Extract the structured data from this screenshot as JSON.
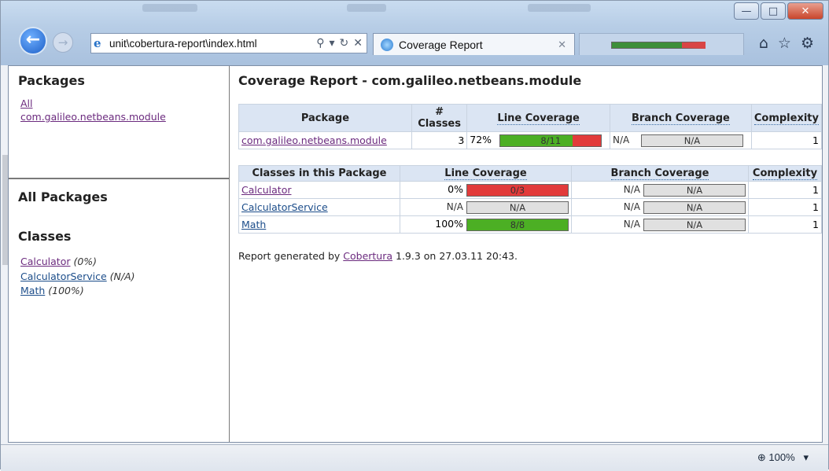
{
  "browser": {
    "address": "unit\\cobertura-report\\index.html",
    "tab_title": "Coverage Report",
    "zoom": "100%"
  },
  "left": {
    "packages_heading": "Packages",
    "package_links": [
      "All",
      "com.galileo.netbeans.module"
    ],
    "all_packages_heading": "All Packages",
    "classes_heading": "Classes",
    "classes": [
      {
        "name": "Calculator",
        "pct": "(0%)"
      },
      {
        "name": "CalculatorService",
        "pct": "(N/A)"
      },
      {
        "name": "Math",
        "pct": "(100%)"
      }
    ]
  },
  "main": {
    "title": "Coverage Report - com.galileo.netbeans.module",
    "package_table": {
      "headers": [
        "Package",
        "# Classes",
        "Line Coverage",
        "Branch Coverage",
        "Complexity"
      ],
      "row": {
        "package": "com.galileo.netbeans.module",
        "classes": "3",
        "line_pct": "72%",
        "line_frac": "8/11",
        "line_value": 0.72,
        "branch_pct": "N/A",
        "branch_bar": "N/A",
        "complexity": "1"
      }
    },
    "class_table": {
      "headers": [
        "Classes in this Package",
        "Line Coverage",
        "Branch Coverage",
        "Complexity"
      ],
      "rows": [
        {
          "name": "Calculator",
          "line_pct": "0%",
          "line_frac": "0/3",
          "line_value": 0,
          "branch_pct": "N/A",
          "branch_bar": "N/A",
          "complexity": "1"
        },
        {
          "name": "CalculatorService",
          "line_pct": "N/A",
          "line_frac": "N/A",
          "line_value": null,
          "branch_pct": "N/A",
          "branch_bar": "N/A",
          "complexity": "1"
        },
        {
          "name": "Math",
          "line_pct": "100%",
          "line_frac": "8/8",
          "line_value": 1,
          "branch_pct": "N/A",
          "branch_bar": "N/A",
          "complexity": "1"
        }
      ]
    },
    "footer_prefix": "Report generated by ",
    "footer_link": "Cobertura",
    "footer_suffix": " 1.9.3 on 27.03.11 20:43."
  },
  "colors": {
    "covered": "#4caf24",
    "uncovered": "#e23b3b",
    "header_bg": "#dbe5f3"
  },
  "icons": [
    "back-arrow-icon",
    "forward-arrow-icon",
    "ie-icon",
    "search-icon",
    "refresh-icon",
    "close-icon",
    "home-icon",
    "favorites-star-icon",
    "settings-gear-icon",
    "zoom-icon"
  ]
}
